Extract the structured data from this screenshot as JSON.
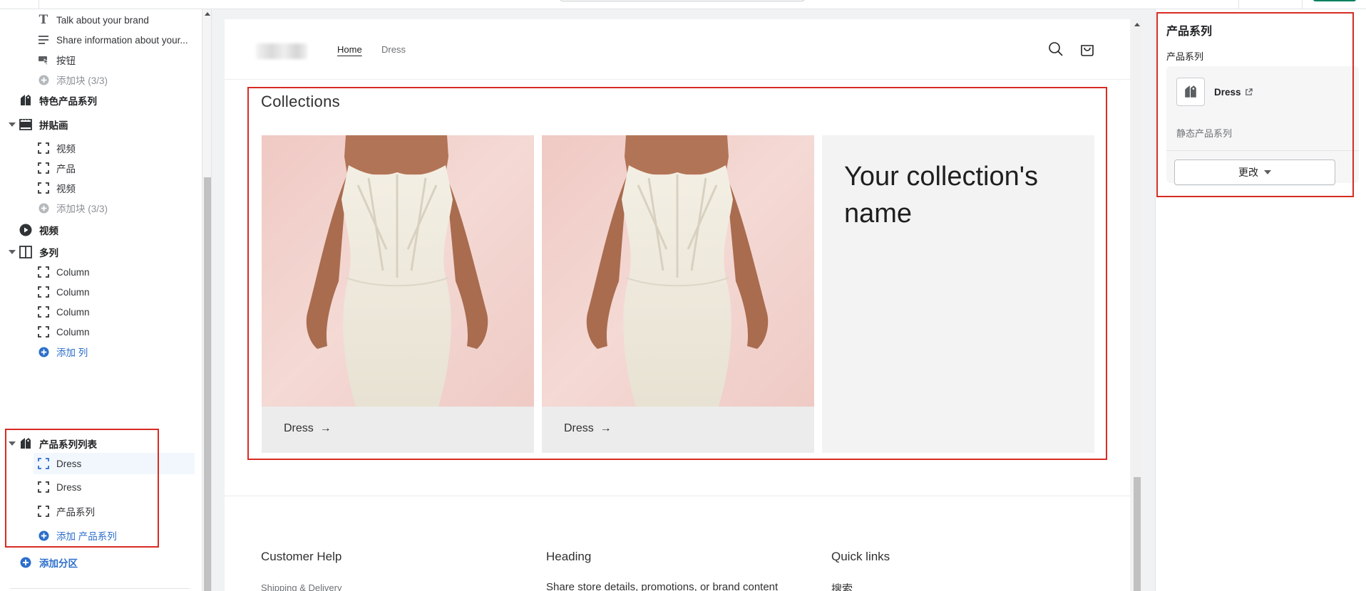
{
  "sidebar": {
    "items": [
      {
        "label": "Talk about your brand"
      },
      {
        "label": "Share information about your..."
      },
      {
        "label": "按钮"
      },
      {
        "label": "添加块 (3/3)"
      },
      {
        "label": "特色产品系列"
      },
      {
        "label": "拼贴画"
      },
      {
        "label": "视频"
      },
      {
        "label": "产品"
      },
      {
        "label": "视频"
      },
      {
        "label": "添加块 (3/3)"
      },
      {
        "label": "视频"
      },
      {
        "label": "多列"
      },
      {
        "label": "Column"
      },
      {
        "label": "Column"
      },
      {
        "label": "Column"
      },
      {
        "label": "Column"
      },
      {
        "label": "添加 列"
      },
      {
        "label": "产品系列列表"
      },
      {
        "label": "Dress"
      },
      {
        "label": "Dress"
      },
      {
        "label": "产品系列"
      },
      {
        "label": "添加 产品系列"
      },
      {
        "label": "添加分区"
      }
    ]
  },
  "preview": {
    "nav": {
      "home": "Home",
      "dress": "Dress"
    },
    "collections_title": "Collections",
    "cards": [
      {
        "caption": "Dress",
        "arrow": "→"
      },
      {
        "caption": "Dress",
        "arrow": "→"
      }
    ],
    "placeholder_name": "Your collection's name",
    "footer": {
      "col1": {
        "heading": "Customer Help",
        "text": "Shipping & Delivery"
      },
      "col2": {
        "heading": "Heading",
        "text": "Share store details, promotions, or brand content"
      },
      "col3": {
        "heading": "Quick links",
        "text": "搜索"
      }
    }
  },
  "right_panel": {
    "title": "产品系列",
    "subtitle": "产品系列",
    "collection_name": "Dress",
    "collection_type": "静态产品系列",
    "change_button": "更改"
  },
  "colors": {
    "accent": "#d72c23",
    "link": "#2c6ecb",
    "primary": "#008060"
  }
}
